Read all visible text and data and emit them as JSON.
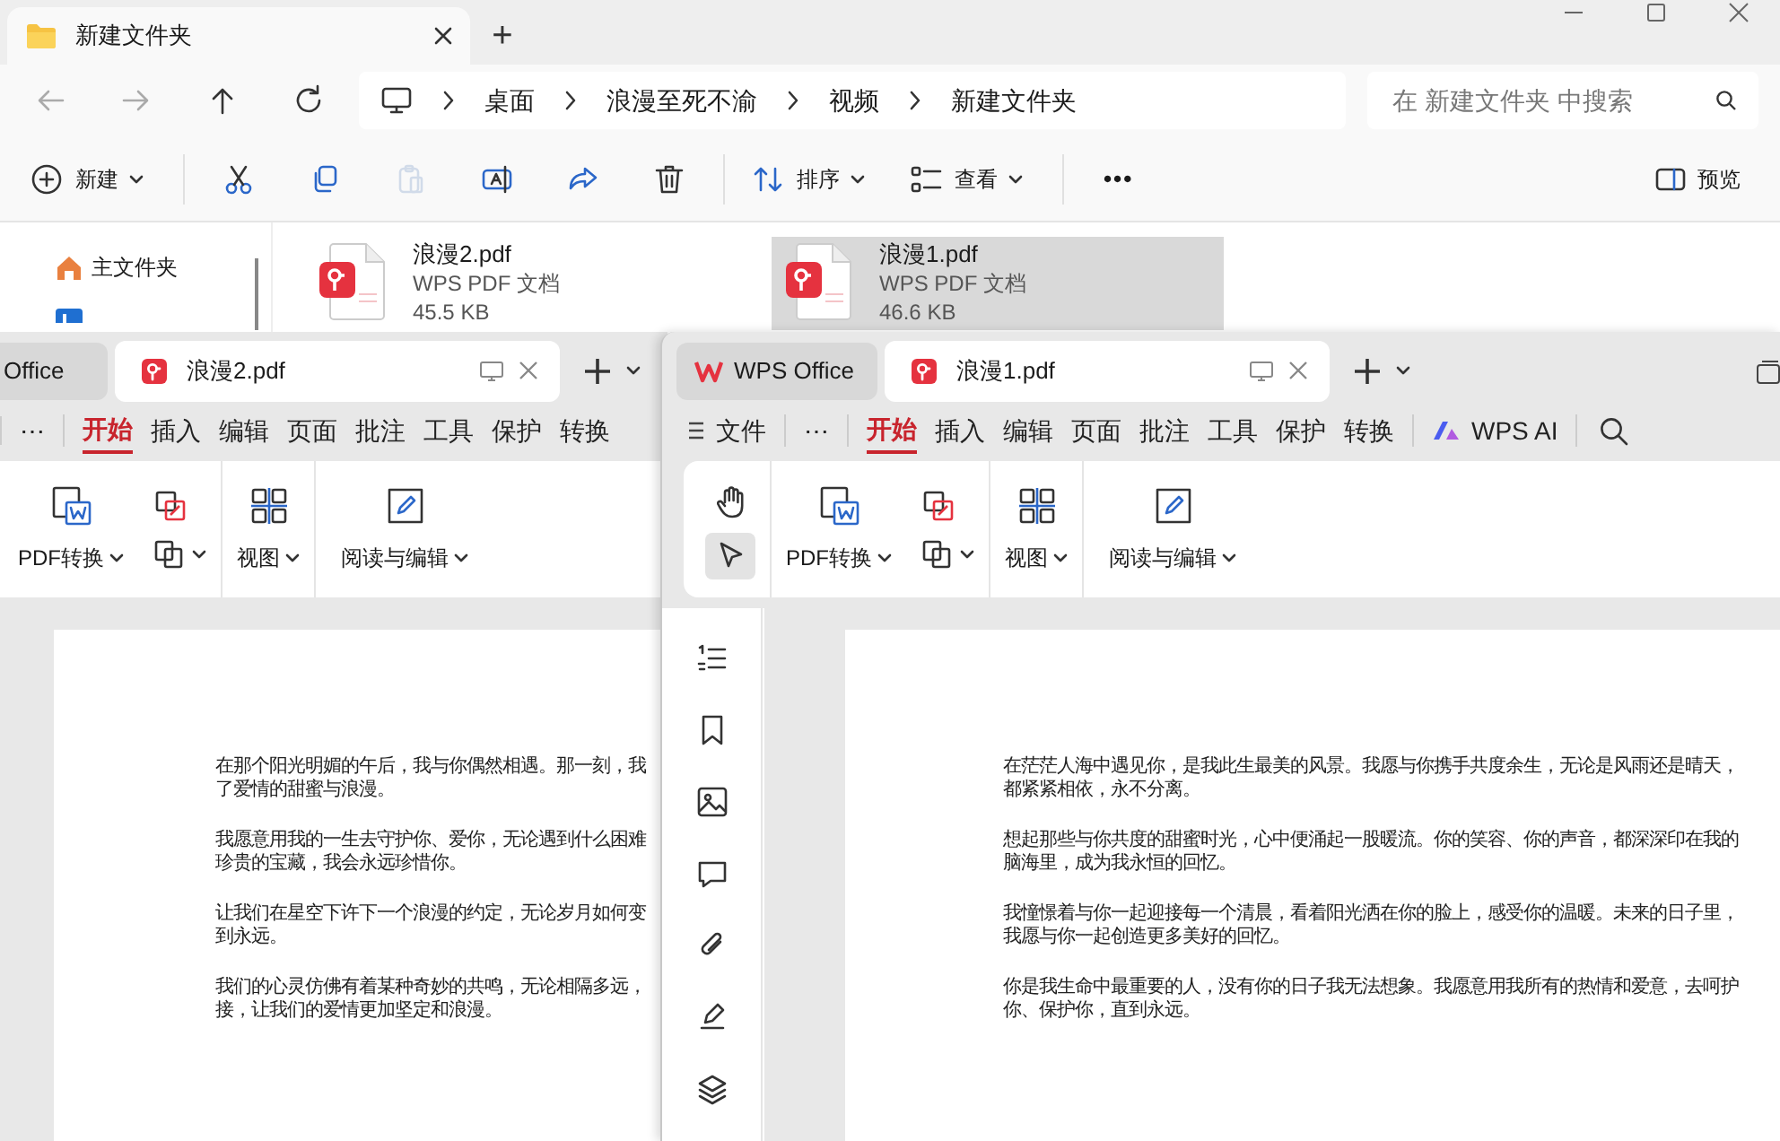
{
  "explorer": {
    "tabs": [
      {
        "title": "新建文件夹"
      }
    ],
    "new_tab": "+",
    "breadcrumb": [
      "桌面",
      "浪漫至死不渝",
      "视频",
      "新建文件夹"
    ],
    "search": {
      "placeholder": "在 新建文件夹 中搜索"
    },
    "commands": [
      {
        "kind": "new",
        "label": "新建",
        "disabled": false
      },
      {
        "kind": "cut",
        "disabled": false
      },
      {
        "kind": "copy",
        "disabled": false
      },
      {
        "kind": "paste",
        "disabled": true
      },
      {
        "kind": "rename",
        "disabled": false
      },
      {
        "kind": "share",
        "disabled": false
      },
      {
        "kind": "delete",
        "disabled": false
      },
      {
        "kind": "sort",
        "label": "排序",
        "disabled": false
      },
      {
        "kind": "view",
        "label": "查看",
        "disabled": false
      },
      {
        "kind": "more",
        "label": "•••",
        "disabled": false
      }
    ],
    "preview": "预览",
    "sidebar": [
      {
        "kind": "home",
        "label": "主文件夹"
      },
      {
        "kind": "gallery"
      }
    ],
    "files": [
      {
        "name": "浪漫2.pdf",
        "type": "WPS PDF 文档",
        "size": "45.5 KB",
        "selected": false
      },
      {
        "name": "浪漫1.pdf",
        "type": "WPS PDF 文档",
        "size": "46.6 KB",
        "selected": true
      }
    ]
  },
  "wps_windows": [
    {
      "tabs": [
        {
          "kind": "home",
          "label": "Office",
          "selected": false
        },
        {
          "kind": "doc",
          "label": "浪漫2.pdf",
          "selected": true
        }
      ],
      "menu": [
        {
          "kind": "more",
          "label": "⋯",
          "selected": false
        },
        {
          "kind": "tab",
          "label": "开始",
          "selected": true
        },
        {
          "kind": "tab",
          "label": "插入",
          "selected": false
        },
        {
          "kind": "tab",
          "label": "编辑",
          "selected": false
        },
        {
          "kind": "tab",
          "label": "页面",
          "selected": false
        },
        {
          "kind": "tab",
          "label": "批注",
          "selected": false
        },
        {
          "kind": "tab",
          "label": "工具",
          "selected": false
        },
        {
          "kind": "tab",
          "label": "保护",
          "selected": false
        },
        {
          "kind": "tab",
          "label": "转换",
          "selected": false
        }
      ],
      "ribbon": [
        {
          "kind": "pdf_convert",
          "label": "PDF转换"
        },
        {
          "kind": "pair"
        },
        {
          "kind": "view",
          "label": "视图"
        },
        {
          "kind": "edit",
          "label": "阅读与编辑"
        }
      ],
      "paragraphs": [
        [
          "在那个阳光明媚的午后，我与你偶然相遇。那一刻，我",
          "了爱情的甜蜜与浪漫。"
        ],
        [
          "我愿意用我的一生去守护你、爱你，无论遇到什么困难",
          "珍贵的宝藏，我会永远珍惜你。"
        ],
        [
          "让我们在星空下许下一个浪漫的约定，无论岁月如何变",
          "到永远。"
        ],
        [
          "我们的心灵仿佛有着某种奇妙的共鸣，无论相隔多远，",
          "接，让我们的爱情更加坚定和浪漫。"
        ]
      ]
    },
    {
      "tabs": [
        {
          "kind": "home",
          "label": "WPS Office",
          "selected": false
        },
        {
          "kind": "doc",
          "label": "浪漫1.pdf",
          "selected": true
        }
      ],
      "menu": [
        {
          "kind": "file",
          "label": "文件",
          "selected": false
        },
        {
          "kind": "more",
          "label": "⋯",
          "selected": false
        },
        {
          "kind": "tab",
          "label": "开始",
          "selected": true
        },
        {
          "kind": "tab",
          "label": "插入",
          "selected": false
        },
        {
          "kind": "tab",
          "label": "编辑",
          "selected": false
        },
        {
          "kind": "tab",
          "label": "页面",
          "selected": false
        },
        {
          "kind": "tab",
          "label": "批注",
          "selected": false
        },
        {
          "kind": "tab",
          "label": "工具",
          "selected": false
        },
        {
          "kind": "tab",
          "label": "保护",
          "selected": false
        },
        {
          "kind": "tab",
          "label": "转换",
          "selected": false
        },
        {
          "kind": "ai",
          "label": "WPS AI",
          "selected": false
        },
        {
          "kind": "search",
          "selected": false
        }
      ],
      "tools": [
        {
          "kind": "hand",
          "selected": false
        },
        {
          "kind": "select",
          "selected": true
        }
      ],
      "ribbon": [
        {
          "kind": "pdf_convert",
          "label": "PDF转换"
        },
        {
          "kind": "pair"
        },
        {
          "kind": "view",
          "label": "视图"
        },
        {
          "kind": "edit",
          "label": "阅读与编辑"
        }
      ],
      "sidebar": true,
      "paragraphs": [
        [
          "在茫茫人海中遇见你，是我此生最美的风景。我愿与你携手共度余生，无论是风雨还是晴天，",
          "都紧紧相依，永不分离。"
        ],
        [
          "想起那些与你共度的甜蜜时光，心中便涌起一股暖流。你的笑容、你的声音，都深深印在我的",
          "脑海里，成为我永恒的回忆。"
        ],
        [
          "我憧憬着与你一起迎接每一个清晨，看着阳光洒在你的脸上，感受你的温暖。未来的日子里，",
          "我愿与你一起创造更多美好的回忆。"
        ],
        [
          "你是我生命中最重要的人，没有你的日子我无法想象。我愿意用我所有的热情和爱意，去呵护",
          "你、保护你，直到永远。"
        ]
      ]
    }
  ]
}
